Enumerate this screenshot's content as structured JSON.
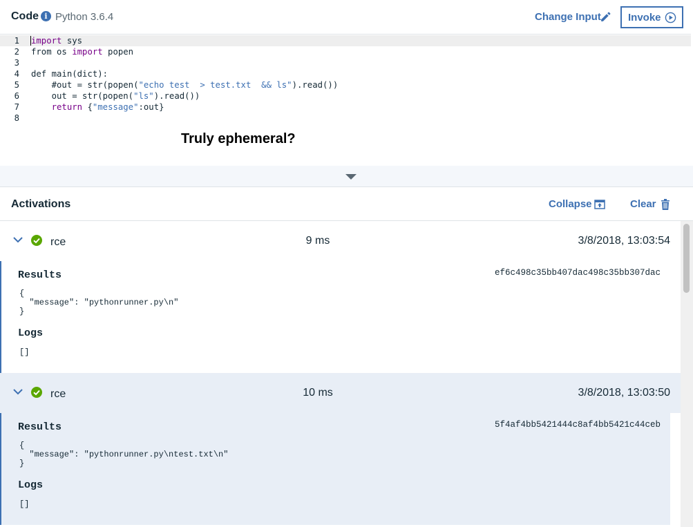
{
  "header": {
    "title": "Code",
    "runtime": "Python 3.6.4",
    "change_input_label": "Change Input",
    "invoke_label": "Invoke"
  },
  "editor": {
    "lines": [
      {
        "n": "1",
        "text": "import sys"
      },
      {
        "n": "2",
        "text": "from os import popen"
      },
      {
        "n": "3",
        "text": ""
      },
      {
        "n": "4",
        "text": "def main(dict):"
      },
      {
        "n": "5",
        "text": "    #out = str(popen(\"echo test  > test.txt  && ls\").read())"
      },
      {
        "n": "6",
        "text": "    out = str(popen(\"ls\").read())"
      },
      {
        "n": "7",
        "text": "    return {\"message\":out}"
      },
      {
        "n": "8",
        "text": ""
      }
    ],
    "overlay_text": "Truly ephemeral?"
  },
  "activations": {
    "title": "Activations",
    "collapse_label": "Collapse",
    "clear_label": "Clear",
    "results_heading": "Results",
    "logs_heading": "Logs",
    "items": [
      {
        "name": "rce",
        "duration": "9 ms",
        "time": "3/8/2018, 13:03:54",
        "id": "ef6c498c35bb407dac498c35bb307dac",
        "result": "{\n  \"message\": \"pythonrunner.py\\n\"\n}",
        "logs": "[]"
      },
      {
        "name": "rce",
        "duration": "10 ms",
        "time": "3/8/2018, 13:03:50",
        "id": "5f4af4bb5421444c8af4bb5421c44ceb",
        "result": "{\n  \"message\": \"pythonrunner.py\\ntest.txt\\n\"\n}",
        "logs": "[]"
      }
    ]
  },
  "colors": {
    "accent": "#3d70b2",
    "success": "#5aa700",
    "selected_bg": "#e8eef6",
    "splitter_bg": "#f4f7fb"
  }
}
